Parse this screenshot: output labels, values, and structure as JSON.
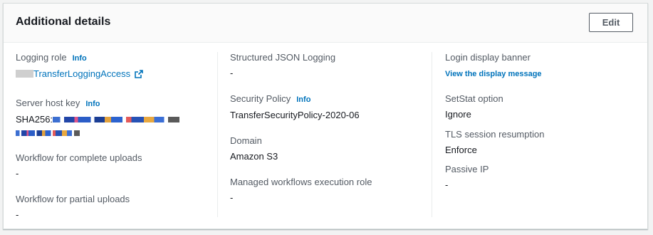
{
  "panel": {
    "title": "Additional details",
    "edit_label": "Edit"
  },
  "info_label": "Info",
  "col1": {
    "logging_role": {
      "label": "Logging role",
      "value": "TransferLoggingAccess"
    },
    "server_host_key": {
      "label": "Server host key",
      "prefix": "SHA256:"
    },
    "workflow_complete": {
      "label": "Workflow for complete uploads",
      "value": "-"
    },
    "workflow_partial": {
      "label": "Workflow for partial uploads",
      "value": "-"
    }
  },
  "col2": {
    "structured_logging": {
      "label": "Structured JSON Logging",
      "value": "-"
    },
    "security_policy": {
      "label": "Security Policy",
      "value": "TransferSecurityPolicy-2020-06"
    },
    "domain": {
      "label": "Domain",
      "value": "Amazon S3"
    },
    "managed_workflows_role": {
      "label": "Managed workflows execution role",
      "value": "-"
    }
  },
  "col3": {
    "login_banner": {
      "label": "Login display banner",
      "link": "View the display message"
    },
    "setstat": {
      "label": "SetStat option",
      "value": "Ignore"
    },
    "tls_resumption": {
      "label": "TLS session resumption",
      "value": "Enforce"
    },
    "passive_ip": {
      "label": "Passive IP",
      "value": "-"
    }
  },
  "colors": {
    "link": "#0073bb",
    "label": "#545b64",
    "text": "#16191f"
  }
}
